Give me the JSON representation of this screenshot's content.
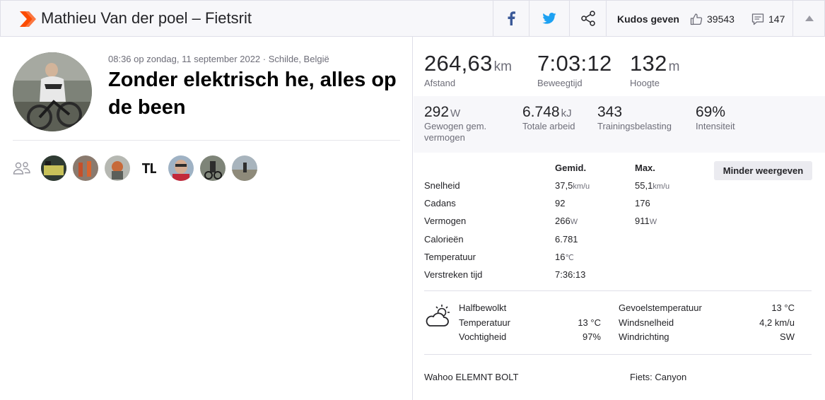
{
  "header": {
    "title": "Mathieu Van der poel – Fietsrit",
    "kudos_label": "Kudos geven",
    "kudos_count": "39543",
    "comment_count": "147",
    "brand_color": "#fc4c02",
    "facebook_color": "#3b5998",
    "twitter_color": "#1da1f2"
  },
  "activity": {
    "meta": "08:36 op zondag, 11 september 2022 · Schilde, België",
    "name": "Zonder elektrisch he, alles op de been"
  },
  "primary_stats": [
    {
      "value": "264,63",
      "unit": "km",
      "label": "Afstand"
    },
    {
      "value": "7:03:12",
      "unit": "",
      "label": "Beweegtijd"
    },
    {
      "value": "132",
      "unit": "m",
      "label": "Hoogte"
    }
  ],
  "secondary_stats": [
    {
      "value": "292",
      "unit": "W",
      "label_line1": "Gewogen gem.",
      "label_line2": "vermogen"
    },
    {
      "value": "6.748",
      "unit": "kJ",
      "label_line1": "Totale arbeid",
      "label_line2": ""
    },
    {
      "value": "343",
      "unit": "",
      "label_line1": "Trainingsbelasting",
      "label_line2": ""
    },
    {
      "value": "69%",
      "unit": "",
      "label_line1": "Intensiteit",
      "label_line2": ""
    }
  ],
  "details": {
    "avg_header": "Gemid.",
    "max_header": "Max.",
    "less_button": "Minder weergeven",
    "rows": [
      {
        "label": "Snelheid",
        "avg": "37,5",
        "avg_unit": "km/u",
        "max": "55,1",
        "max_unit": "km/u"
      },
      {
        "label": "Cadans",
        "avg": "92",
        "avg_unit": "",
        "max": "176",
        "max_unit": ""
      },
      {
        "label": "Vermogen",
        "avg": "266",
        "avg_unit": "W",
        "max": "911",
        "max_unit": "W"
      },
      {
        "label": "Calorieën",
        "avg": "6.781",
        "avg_unit": "",
        "max": "",
        "max_unit": ""
      },
      {
        "label": "Temperatuur",
        "avg": "16",
        "avg_unit": "℃",
        "max": "",
        "max_unit": ""
      },
      {
        "label": "Verstreken tijd",
        "avg": "7:36:13",
        "avg_unit": "",
        "max": "",
        "max_unit": ""
      }
    ]
  },
  "weather": {
    "icon": "partly-cloudy-icon",
    "condition": "Halfbewolkt",
    "temp_label": "Temperatuur",
    "temp_value": "13 °C",
    "humidity_label": "Vochtigheid",
    "humidity_value": "97%",
    "feels_label": "Gevoelstemperatuur",
    "feels_value": "13 °C",
    "wind_speed_label": "Windsnelheid",
    "wind_speed_value": "4,2 km/u",
    "wind_dir_label": "Windrichting",
    "wind_dir_value": "SW"
  },
  "equipment": {
    "device": "Wahoo ELEMNT BOLT",
    "bike": "Fiets: Canyon"
  }
}
